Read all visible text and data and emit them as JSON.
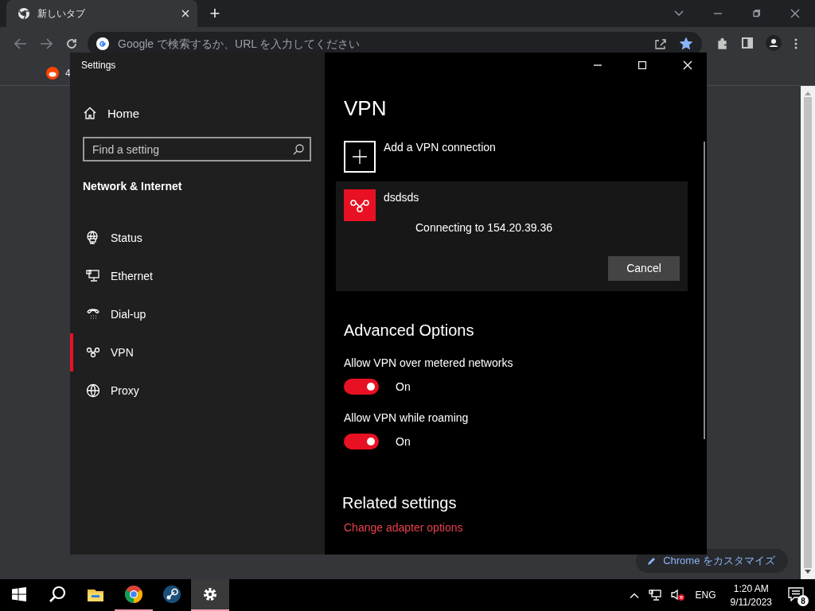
{
  "browser": {
    "tab": {
      "title": "新しいタブ",
      "selected": true
    },
    "new_tab_button": "+",
    "address_bar": {
      "placeholder": "Google で検索するか、URL を入力してください"
    },
    "bookmarks": [
      {
        "label": "4"
      }
    ],
    "customize_button": "Chrome をカスタマイズ"
  },
  "settings": {
    "window": {
      "title": "Settings"
    },
    "home": "Home",
    "search": {
      "placeholder": "Find a setting"
    },
    "section": "Network & Internet",
    "nav": [
      {
        "label": "Status",
        "kind": "status",
        "selected": false
      },
      {
        "label": "Ethernet",
        "kind": "ethernet",
        "selected": false
      },
      {
        "label": "Dial-up",
        "kind": "dialup",
        "selected": false
      },
      {
        "label": "VPN",
        "kind": "vpn",
        "selected": true
      },
      {
        "label": "Proxy",
        "kind": "proxy",
        "selected": false
      }
    ],
    "page_title": "VPN",
    "add_vpn": "Add a VPN connection",
    "connection": {
      "name": "dsdsds",
      "status": "Connecting to 154.20.39.36",
      "button": "Cancel"
    },
    "advanced_title": "Advanced Options",
    "toggles": [
      {
        "label": "Allow VPN over metered networks",
        "on": true,
        "state_text": "On"
      },
      {
        "label": "Allow VPN while roaming",
        "on": true,
        "state_text": "On"
      }
    ],
    "related_title": "Related settings",
    "related_link": "Change adapter options"
  },
  "taskbar": {
    "apps": [
      {
        "kind": "explorer",
        "running": false,
        "selected": false
      },
      {
        "kind": "chrome",
        "running": true,
        "selected": false
      },
      {
        "kind": "steam",
        "running": false,
        "selected": false
      },
      {
        "kind": "settings",
        "running": true,
        "selected": true
      }
    ],
    "language": "ENG",
    "time": "1:20 AM",
    "date": "9/11/2023",
    "notification_count": "8"
  }
}
